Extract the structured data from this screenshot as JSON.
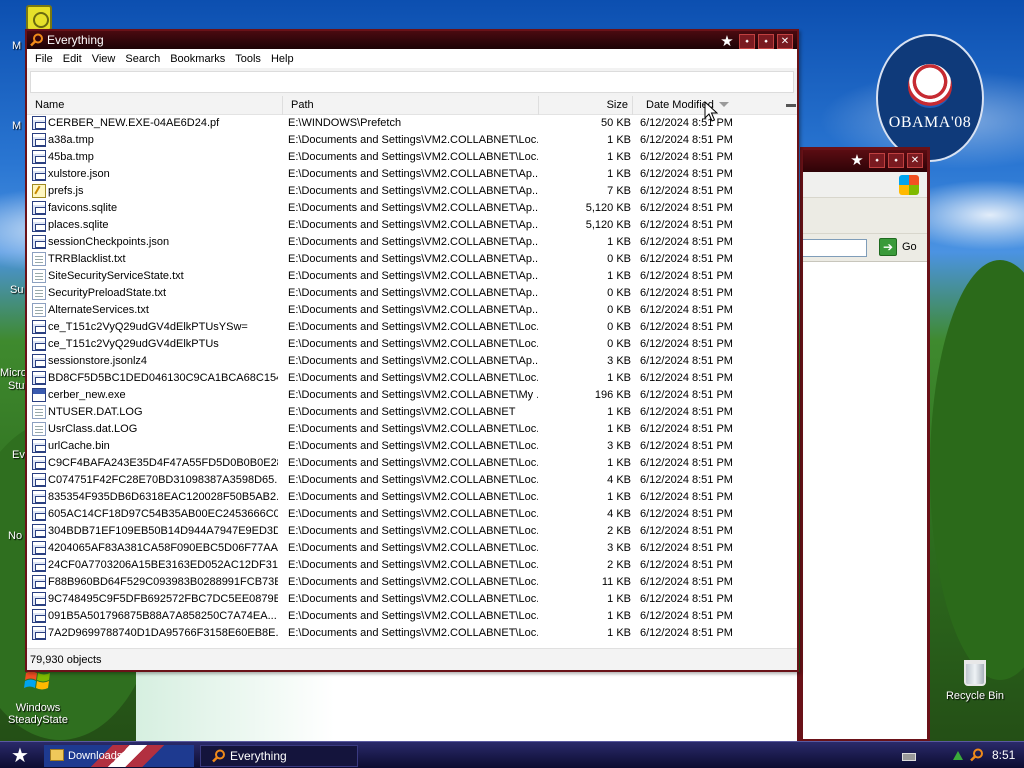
{
  "desktop": {
    "edge_labels": [
      "M",
      "M",
      "Su",
      "Micro",
      "Stu",
      "Ev",
      "No"
    ],
    "icons": [
      {
        "label": "Windows SteadyState"
      },
      {
        "label": "Recycle Bin"
      }
    ],
    "badge_text": "OBAMA'08"
  },
  "everything_window": {
    "title": "Everything",
    "menu": [
      "File",
      "Edit",
      "View",
      "Search",
      "Bookmarks",
      "Tools",
      "Help"
    ],
    "search": {
      "value": "",
      "placeholder": ""
    },
    "columns": {
      "name": "Name",
      "path": "Path",
      "size": "Size",
      "date": "Date Modified"
    },
    "sort": {
      "column": "Date Modified",
      "direction": "descending"
    },
    "rows": [
      {
        "icon": "system-file-icon",
        "name": "CERBER_NEW.EXE-04AE6D24.pf",
        "path": "E:\\WINDOWS\\Prefetch",
        "size": "50 KB",
        "date": "6/12/2024 8:51 PM"
      },
      {
        "icon": "system-file-icon",
        "name": "a38a.tmp",
        "path": "E:\\Documents and Settings\\VM2.COLLABNET\\Loc...",
        "size": "1 KB",
        "date": "6/12/2024 8:51 PM"
      },
      {
        "icon": "system-file-icon",
        "name": "45ba.tmp",
        "path": "E:\\Documents and Settings\\VM2.COLLABNET\\Loc...",
        "size": "1 KB",
        "date": "6/12/2024 8:51 PM"
      },
      {
        "icon": "system-file-icon",
        "name": "xulstore.json",
        "path": "E:\\Documents and Settings\\VM2.COLLABNET\\Ap...",
        "size": "1 KB",
        "date": "6/12/2024 8:51 PM"
      },
      {
        "icon": "script-file-icon",
        "name": "prefs.js",
        "path": "E:\\Documents and Settings\\VM2.COLLABNET\\Ap...",
        "size": "7 KB",
        "date": "6/12/2024 8:51 PM"
      },
      {
        "icon": "system-file-icon",
        "name": "favicons.sqlite",
        "path": "E:\\Documents and Settings\\VM2.COLLABNET\\Ap...",
        "size": "5,120 KB",
        "date": "6/12/2024 8:51 PM"
      },
      {
        "icon": "system-file-icon",
        "name": "places.sqlite",
        "path": "E:\\Documents and Settings\\VM2.COLLABNET\\Ap...",
        "size": "5,120 KB",
        "date": "6/12/2024 8:51 PM"
      },
      {
        "icon": "system-file-icon",
        "name": "sessionCheckpoints.json",
        "path": "E:\\Documents and Settings\\VM2.COLLABNET\\Ap...",
        "size": "1 KB",
        "date": "6/12/2024 8:51 PM"
      },
      {
        "icon": "text-file-icon",
        "name": "TRRBlacklist.txt",
        "path": "E:\\Documents and Settings\\VM2.COLLABNET\\Ap...",
        "size": "0 KB",
        "date": "6/12/2024 8:51 PM"
      },
      {
        "icon": "text-file-icon",
        "name": "SiteSecurityServiceState.txt",
        "path": "E:\\Documents and Settings\\VM2.COLLABNET\\Ap...",
        "size": "1 KB",
        "date": "6/12/2024 8:51 PM"
      },
      {
        "icon": "text-file-icon",
        "name": "SecurityPreloadState.txt",
        "path": "E:\\Documents and Settings\\VM2.COLLABNET\\Ap...",
        "size": "0 KB",
        "date": "6/12/2024 8:51 PM"
      },
      {
        "icon": "text-file-icon",
        "name": "AlternateServices.txt",
        "path": "E:\\Documents and Settings\\VM2.COLLABNET\\Ap...",
        "size": "0 KB",
        "date": "6/12/2024 8:51 PM"
      },
      {
        "icon": "system-file-icon",
        "name": "ce_T151c2VyQ29udGV4dElkPTUsYSw=",
        "path": "E:\\Documents and Settings\\VM2.COLLABNET\\Loc...",
        "size": "0 KB",
        "date": "6/12/2024 8:51 PM"
      },
      {
        "icon": "system-file-icon",
        "name": "ce_T151c2VyQ29udGV4dElkPTUs",
        "path": "E:\\Documents and Settings\\VM2.COLLABNET\\Loc...",
        "size": "0 KB",
        "date": "6/12/2024 8:51 PM"
      },
      {
        "icon": "system-file-icon",
        "name": "sessionstore.jsonlz4",
        "path": "E:\\Documents and Settings\\VM2.COLLABNET\\Ap...",
        "size": "3 KB",
        "date": "6/12/2024 8:51 PM"
      },
      {
        "icon": "system-file-icon",
        "name": "BD8CF5D5BC1DED046130C9CA1BCA68C154...",
        "path": "E:\\Documents and Settings\\VM2.COLLABNET\\Loc...",
        "size": "1 KB",
        "date": "6/12/2024 8:51 PM"
      },
      {
        "icon": "application-icon",
        "name": "cerber_new.exe",
        "path": "E:\\Documents and Settings\\VM2.COLLABNET\\My ...",
        "size": "196 KB",
        "date": "6/12/2024 8:51 PM"
      },
      {
        "icon": "text-file-icon",
        "name": "NTUSER.DAT.LOG",
        "path": "E:\\Documents and Settings\\VM2.COLLABNET",
        "size": "1 KB",
        "date": "6/12/2024 8:51 PM"
      },
      {
        "icon": "text-file-icon",
        "name": "UsrClass.dat.LOG",
        "path": "E:\\Documents and Settings\\VM2.COLLABNET\\Loc...",
        "size": "1 KB",
        "date": "6/12/2024 8:51 PM"
      },
      {
        "icon": "system-file-icon",
        "name": "urlCache.bin",
        "path": "E:\\Documents and Settings\\VM2.COLLABNET\\Loc...",
        "size": "3 KB",
        "date": "6/12/2024 8:51 PM"
      },
      {
        "icon": "system-file-icon",
        "name": "C9CF4BAFA243E35D4F47A55FD5D0B0B0E28...",
        "path": "E:\\Documents and Settings\\VM2.COLLABNET\\Loc...",
        "size": "1 KB",
        "date": "6/12/2024 8:51 PM"
      },
      {
        "icon": "system-file-icon",
        "name": "C074751F42FC28E70BD31098387A3598D65...",
        "path": "E:\\Documents and Settings\\VM2.COLLABNET\\Loc...",
        "size": "4 KB",
        "date": "6/12/2024 8:51 PM"
      },
      {
        "icon": "system-file-icon",
        "name": "835354F935DB6D6318EAC120028F50B5AB2...",
        "path": "E:\\Documents and Settings\\VM2.COLLABNET\\Loc...",
        "size": "1 KB",
        "date": "6/12/2024 8:51 PM"
      },
      {
        "icon": "system-file-icon",
        "name": "605AC14CF18D97C54B35AB00EC2453666C0...",
        "path": "E:\\Documents and Settings\\VM2.COLLABNET\\Loc...",
        "size": "4 KB",
        "date": "6/12/2024 8:51 PM"
      },
      {
        "icon": "system-file-icon",
        "name": "304BDB71EF109EB50B14D944A7947E9ED3D...",
        "path": "E:\\Documents and Settings\\VM2.COLLABNET\\Loc...",
        "size": "2 KB",
        "date": "6/12/2024 8:51 PM"
      },
      {
        "icon": "system-file-icon",
        "name": "4204065AF83A381CA58F090EBC5D06F77AA...",
        "path": "E:\\Documents and Settings\\VM2.COLLABNET\\Loc...",
        "size": "3 KB",
        "date": "6/12/2024 8:51 PM"
      },
      {
        "icon": "system-file-icon",
        "name": "24CF0A7703206A15BE3163ED052AC12DF31...",
        "path": "E:\\Documents and Settings\\VM2.COLLABNET\\Loc...",
        "size": "2 KB",
        "date": "6/12/2024 8:51 PM"
      },
      {
        "icon": "system-file-icon",
        "name": "F88B960BD64F529C093983B0288991FCB73E...",
        "path": "E:\\Documents and Settings\\VM2.COLLABNET\\Loc...",
        "size": "11 KB",
        "date": "6/12/2024 8:51 PM"
      },
      {
        "icon": "system-file-icon",
        "name": "9C748495C9F5DFB692572FBC7DC5EE0879B...",
        "path": "E:\\Documents and Settings\\VM2.COLLABNET\\Loc...",
        "size": "1 KB",
        "date": "6/12/2024 8:51 PM"
      },
      {
        "icon": "system-file-icon",
        "name": "091B5A501796875B88A7A858250C7A74EA...",
        "path": "E:\\Documents and Settings\\VM2.COLLABNET\\Loc...",
        "size": "1 KB",
        "date": "6/12/2024 8:51 PM"
      },
      {
        "icon": "system-file-icon",
        "name": "7A2D9699788740D1DA95766F3158E60EB8E...",
        "path": "E:\\Documents and Settings\\VM2.COLLABNET\\Loc...",
        "size": "1 KB",
        "date": "6/12/2024 8:51 PM"
      }
    ],
    "status": "79,930 objects"
  },
  "background_window": {
    "go_label": "Go"
  },
  "taskbar": {
    "items": [
      {
        "label": "Downloads"
      },
      {
        "label": "Everything"
      }
    ],
    "clock": "8:51 PM"
  },
  "colors": {
    "window_frame": "#6a1218",
    "title_bar": "#1c0306",
    "taskbar": "#0c0c30",
    "desktop_sky": "#2a76d2"
  }
}
